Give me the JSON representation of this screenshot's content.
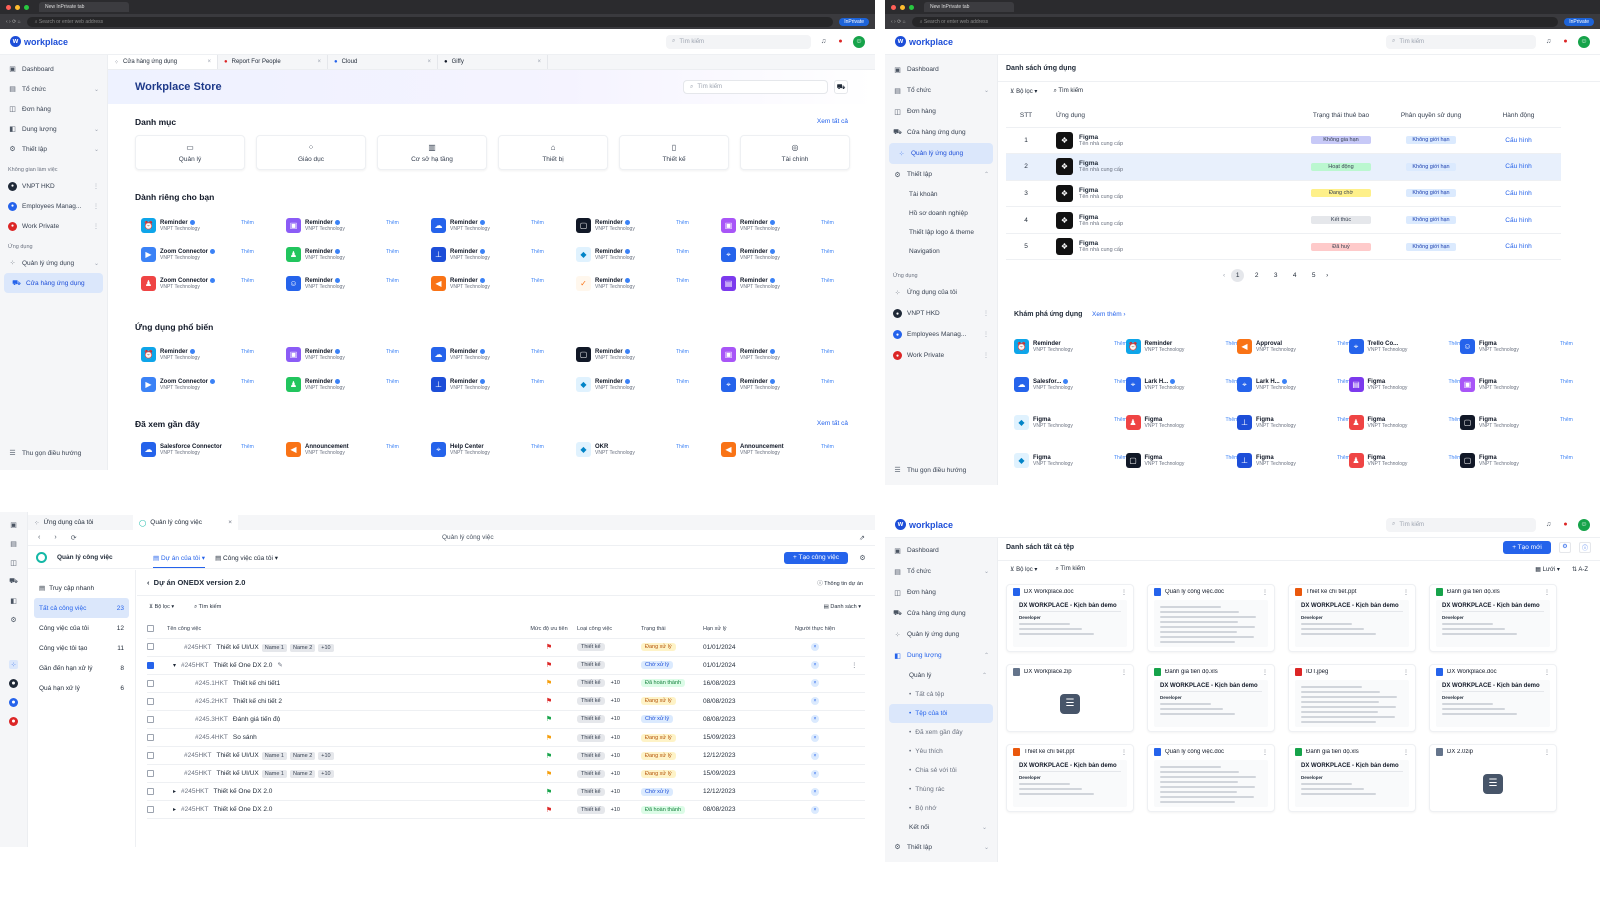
{
  "browser": {
    "tab_title": "New InPrivate tab",
    "address_placeholder": "Search or enter web address",
    "inprivate": "InPrivate"
  },
  "brand": {
    "logo_text": "workplace",
    "search_placeholder": "Tìm kiếm"
  },
  "store": {
    "sidebar": {
      "items": [
        "Dashboard",
        "Tổ chức",
        "Đơn hàng",
        "Dung lượng",
        "Thiết lập"
      ],
      "workspace_group": "Không gian làm việc",
      "workspaces": [
        "VNPT HKD",
        "Employees Manag...",
        "Work Private"
      ],
      "apps_group": "Ứng dụng",
      "apps": [
        "Quản lý ứng dụng",
        "Cửa hàng ứng dụng"
      ],
      "collapse": "Thu gọn điều hướng"
    },
    "tabs": [
      "Cửa hàng ứng dụng",
      "Report For People",
      "Cloud",
      "Giffy"
    ],
    "title": "Workplace Store",
    "search_placeholder": "Tìm kiếm",
    "categories_title": "Danh mục",
    "see_all": "Xem tất cả",
    "categories": [
      "Quản lý",
      "Giáo dục",
      "Cơ sở hạ tầng",
      "Thiết bị",
      "Thiết kế",
      "Tài chính"
    ],
    "for_you_title": "Dành riêng cho bạn",
    "add_label": "Thêm",
    "vendor": "VNPT Technology",
    "for_you": [
      [
        "Reminder",
        "Reminder",
        "Reminder",
        "Reminder",
        "Reminder"
      ],
      [
        "Zoom Connector",
        "Reminder",
        "Reminder",
        "Reminder",
        "Reminder"
      ],
      [
        "Zoom Connector",
        "Reminder",
        "Reminder",
        "Reminder",
        "Reminder"
      ]
    ],
    "popular_title": "Ứng dụng phổ biến",
    "popular": [
      [
        "Reminder",
        "Reminder",
        "Reminder",
        "Reminder",
        "Reminder"
      ],
      [
        "Zoom Connector",
        "Reminder",
        "Reminder",
        "Reminder",
        "Reminder"
      ]
    ],
    "recent_title": "Đã xem gần đây",
    "recent": [
      "Salesforce Connector",
      "Announcement",
      "Help Center",
      "OKR",
      "Announcement"
    ]
  },
  "manage": {
    "sidebar": {
      "items": [
        "Dashboard",
        "Tổ chức",
        "Đơn hàng",
        "Cửa hàng ứng dụng",
        "Quản lý ứng dụng",
        "Thiết lập"
      ],
      "settings_sub": [
        "Tài khoản",
        "Hồ sơ doanh nghiệp",
        "Thiết lập logo & theme",
        "Navigation"
      ],
      "apps_group": "Ứng dụng",
      "apps": [
        "Ứng dụng của tôi",
        "VNPT HKD",
        "Employees Manag...",
        "Work Private"
      ],
      "collapse": "Thu gọn điều hướng"
    },
    "title": "Danh sách ứng dụng",
    "filter": "Bộ lọc",
    "search": "Tìm kiếm",
    "columns": [
      "STT",
      "Ứng dụng",
      "Trạng thái thuê bao",
      "Phân quyền sử dụng",
      "Hành động"
    ],
    "rows": [
      {
        "stt": "1",
        "name": "Figma",
        "vendor": "Tên nhà cung cấp",
        "status": "Không gia hạn",
        "status_color": "#c7c9f7",
        "perm": "Không giới hạn",
        "action": "Cấu hình"
      },
      {
        "stt": "2",
        "name": "Figma",
        "vendor": "Tên nhà cung cấp",
        "status": "Hoạt động",
        "status_color": "#bbf7d0",
        "perm": "Không giới hạn",
        "action": "Cấu hình"
      },
      {
        "stt": "3",
        "name": "Figma",
        "vendor": "Tên nhà cung cấp",
        "status": "Đang chờ",
        "status_color": "#fef08a",
        "perm": "Không giới hạn",
        "action": "Cấu hình"
      },
      {
        "stt": "4",
        "name": "Figma",
        "vendor": "Tên nhà cung cấp",
        "status": "Kết thúc",
        "status_color": "#e5e7eb",
        "perm": "Không giới hạn",
        "action": "Cấu hình"
      },
      {
        "stt": "5",
        "name": "Figma",
        "vendor": "Tên nhà cung cấp",
        "status": "Đã huỷ",
        "status_color": "#fecaca",
        "perm": "Không giới hạn",
        "action": "Cấu hình"
      }
    ],
    "pages": [
      "1",
      "2",
      "3",
      "4",
      "5"
    ],
    "explore_title": "Khám phá ứng dụng",
    "see_more": "Xem thêm",
    "add_label": "Thêm",
    "vendor": "VNPT Technology",
    "explore": [
      [
        "Reminder",
        "Reminder",
        "Approval",
        "Trello Co...",
        "Figma"
      ],
      [
        "Salesfor...",
        "Lark H...",
        "Lark H...",
        "Figma",
        "Figma"
      ],
      [
        "Figma",
        "Figma",
        "Figma",
        "Figma",
        "Figma"
      ],
      [
        "Figma",
        "Figma",
        "Figma",
        "Figma",
        "Figma"
      ]
    ]
  },
  "tasks": {
    "tabs": [
      "Ứng dụng của tôi",
      "Quản lý công việc"
    ],
    "window_title": "Quản lý công việc",
    "app_name": "Quản lý công việc",
    "view_tabs": [
      "Dự án của tôi",
      "Công việc của tôi"
    ],
    "create_btn": "+ Tạo công việc",
    "side": [
      {
        "label": "Truy cập nhanh",
        "count": ""
      },
      {
        "label": "Tất cả công việc",
        "count": "23"
      },
      {
        "label": "Công việc của tôi",
        "count": "12"
      },
      {
        "label": "Công việc tôi tạo",
        "count": "11"
      },
      {
        "label": "Gần đến hạn xử lý",
        "count": "8"
      },
      {
        "label": "Quá hạn xử lý",
        "count": "6"
      }
    ],
    "project": "Dự án ONEDX version 2.0",
    "project_info": "Thông tin dự án",
    "filter": "Bộ lọc",
    "search": "Tìm kiếm",
    "sort": "Danh sách",
    "columns": [
      "Tên công việc",
      "Mức độ ưu tiên",
      "Loại công việc",
      "Trạng thái",
      "Hạn xử lý",
      "Người thực hiện"
    ],
    "rows": [
      {
        "code": "#245HKT",
        "name": "Thiết kế UI/UX",
        "tags": [
          "Name 1",
          "Name 2",
          "+10"
        ],
        "flag": "#dc2626",
        "type": "Thiết kế",
        "extra": "",
        "status": "Đang xử lý",
        "sbg": "#fef3c7",
        "sfg": "#b45309",
        "due": "01/01/2024",
        "checked": false,
        "indent": 0,
        "arrow": ""
      },
      {
        "code": "#245HKT",
        "name": "Thiết kế One DX 2.0",
        "tags": [],
        "flag": "#dc2626",
        "type": "Thiết kế",
        "extra": "",
        "status": "Chờ xử lý",
        "sbg": "#dbeafe",
        "sfg": "#1d4ed8",
        "due": "01/01/2024",
        "checked": true,
        "indent": 0,
        "arrow": "▾"
      },
      {
        "code": "#245.1HKT",
        "name": "Thiết kế chi tiết1",
        "tags": [],
        "flag": "#f59e0b",
        "type": "Thiết kế",
        "extra": "+10",
        "status": "Đã hoàn thành",
        "sbg": "#dcfce7",
        "sfg": "#15803d",
        "due": "16/08/2023",
        "checked": false,
        "indent": 1,
        "arrow": ""
      },
      {
        "code": "#245.2HKT",
        "name": "Thiết kế chi tiết 2",
        "tags": [],
        "flag": "#dc2626",
        "type": "Thiết kế",
        "extra": "+10",
        "status": "Đang xử lý",
        "sbg": "#fef3c7",
        "sfg": "#b45309",
        "due": "08/08/2023",
        "checked": false,
        "indent": 1,
        "arrow": ""
      },
      {
        "code": "#245.3HKT",
        "name": "Đánh giá tiến độ",
        "tags": [],
        "flag": "#16a34a",
        "type": "Thiết kế",
        "extra": "+10",
        "status": "Chờ xử lý",
        "sbg": "#dbeafe",
        "sfg": "#1d4ed8",
        "due": "08/08/2023",
        "checked": false,
        "indent": 1,
        "arrow": ""
      },
      {
        "code": "#245.4HKT",
        "name": "So sánh",
        "tags": [],
        "flag": "#f59e0b",
        "type": "Thiết kế",
        "extra": "+10",
        "status": "Đang xử lý",
        "sbg": "#fef3c7",
        "sfg": "#b45309",
        "due": "15/09/2023",
        "checked": false,
        "indent": 1,
        "arrow": ""
      },
      {
        "code": "#245HKT",
        "name": "Thiết kế UI/UX",
        "tags": [
          "Name 1",
          "Name 2",
          "+10"
        ],
        "flag": "#16a34a",
        "type": "Thiết kế",
        "extra": "+10",
        "status": "Đang xử lý",
        "sbg": "#fef3c7",
        "sfg": "#b45309",
        "due": "12/12/2023",
        "checked": false,
        "indent": 0,
        "arrow": ""
      },
      {
        "code": "#245HKT",
        "name": "Thiết kế UI/UX",
        "tags": [
          "Name 1",
          "Name 2",
          "+10"
        ],
        "flag": "#f59e0b",
        "type": "Thiết kế",
        "extra": "+10",
        "status": "Đang xử lý",
        "sbg": "#fef3c7",
        "sfg": "#b45309",
        "due": "15/09/2023",
        "checked": false,
        "indent": 0,
        "arrow": ""
      },
      {
        "code": "#245HKT",
        "name": "Thiết kế One DX 2.0",
        "tags": [],
        "flag": "#16a34a",
        "type": "Thiết kế",
        "extra": "+10",
        "status": "Chờ xử lý",
        "sbg": "#dbeafe",
        "sfg": "#1d4ed8",
        "due": "12/12/2023",
        "checked": false,
        "indent": 0,
        "arrow": "▸"
      },
      {
        "code": "#245HKT",
        "name": "Thiết kế One DX 2.0",
        "tags": [],
        "flag": "#dc2626",
        "type": "Thiết kế",
        "extra": "+10",
        "status": "Đã hoàn thành",
        "sbg": "#dcfce7",
        "sfg": "#15803d",
        "due": "08/08/2023",
        "checked": false,
        "indent": 0,
        "arrow": "▸"
      }
    ]
  },
  "files": {
    "sidebar": {
      "items": [
        "Dashboard",
        "Tổ chức",
        "Đơn hàng",
        "Cửa hàng ứng dụng",
        "Quản lý ứng dụng",
        "Dung lượng"
      ],
      "manage": "Quản lý",
      "sub": [
        "Tất cả tệp",
        "Tệp của tôi",
        "Đã xem gần đây",
        "Yêu thích",
        "Chia sẻ với tôi",
        "Thùng rác",
        "Bộ nhớ"
      ],
      "connect": "Kết nối",
      "settings": "Thiết lập"
    },
    "title": "Danh sách tất cả tệp",
    "new_btn": "+ Tạo mới",
    "filter": "Bộ lọc",
    "search": "Tìm kiếm",
    "grid": "Lưới",
    "sort": "A-Z",
    "doc_heading": "DX WORKPLACE - Kịch bản demo",
    "doc_sub": "Developer",
    "cards": [
      {
        "name": "DX Workplace.doc",
        "color": "#2563eb",
        "kind": "doc"
      },
      {
        "name": "Quản lý công việc.doc",
        "color": "#2563eb",
        "kind": "sheet"
      },
      {
        "name": "Thiết kế chi tiết.ppt",
        "color": "#ea580c",
        "kind": "doc"
      },
      {
        "name": "Đánh giá tiến độ.xls",
        "color": "#16a34a",
        "kind": "doc"
      },
      {
        "name": "DX Workplace.zip",
        "color": "#64748b",
        "kind": "zip"
      },
      {
        "name": "Đánh giá tiến độ.xls",
        "color": "#16a34a",
        "kind": "doc"
      },
      {
        "name": "IOT.jpeg",
        "color": "#dc2626",
        "kind": "sheet"
      },
      {
        "name": "DX Workplace.doc",
        "color": "#2563eb",
        "kind": "doc"
      },
      {
        "name": "Thiết kế chi tiết.ppt",
        "color": "#ea580c",
        "kind": "doc"
      },
      {
        "name": "Quản lý công việc.doc",
        "color": "#2563eb",
        "kind": "sheet"
      },
      {
        "name": "Đánh giá tiến độ.xls",
        "color": "#16a34a",
        "kind": "doc"
      },
      {
        "name": "DX 2.0zip",
        "color": "#64748b",
        "kind": "zip"
      }
    ]
  }
}
